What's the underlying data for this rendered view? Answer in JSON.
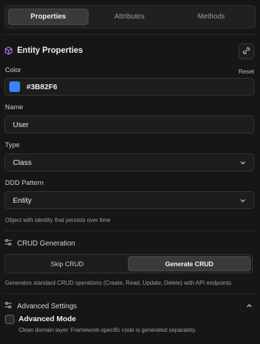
{
  "tabs": [
    {
      "label": "Properties",
      "active": true
    },
    {
      "label": "Attributes",
      "active": false
    },
    {
      "label": "Methods",
      "active": false
    }
  ],
  "section": {
    "title": "Entity Properties",
    "icon": "cube-icon"
  },
  "color": {
    "label": "Color",
    "reset": "Reset",
    "value": "#3B82F6",
    "swatch": "#3B82F6"
  },
  "name": {
    "label": "Name",
    "value": "User"
  },
  "type": {
    "label": "Type",
    "value": "Class"
  },
  "ddd": {
    "label": "DDD Pattern",
    "value": "Entity",
    "help": "Object with identity that persists over time"
  },
  "crud": {
    "title": "CRUD Generation",
    "skip": "Skip CRUD",
    "generate": "Generate CRUD",
    "selected": "generate",
    "help": "Generates standard CRUD operations (Create, Read, Update, Delete) with API endpoints."
  },
  "advanced": {
    "title": "Advanced Settings",
    "mode_label": "Advanced Mode",
    "mode_checked": false,
    "help": "Clean domain layer. Framework-specific code is generated separately."
  }
}
